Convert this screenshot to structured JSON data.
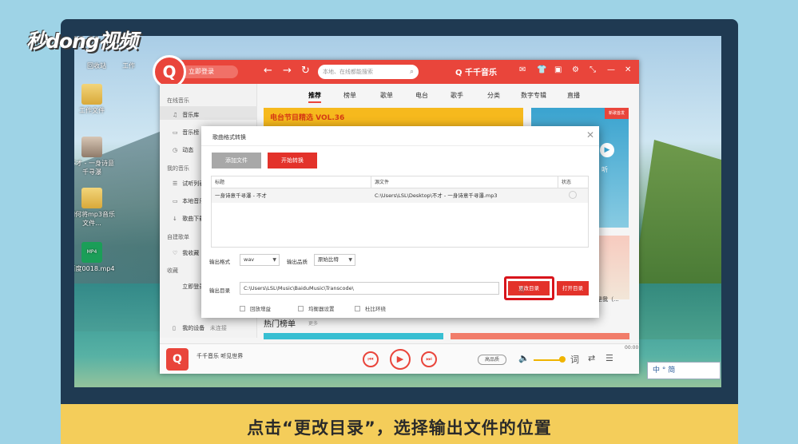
{
  "logo": "秒dong视频",
  "caption": "点击“更改目录”，选择输出文件的位置",
  "desktop_icons": [
    {
      "label": "回收站"
    },
    {
      "label": "工作"
    },
    {
      "label": "工作文件"
    },
    {
      "label": "不才 - 一身诗意千寻瀑"
    },
    {
      "label": "如何将mp3音乐文件..."
    },
    {
      "label": "百度0018.mp4",
      "badge": "MP4"
    }
  ],
  "app": {
    "logo_letter": "Q",
    "login": "立即登录",
    "search_placeholder": "本地、在线都能搜索",
    "brand": "千千音乐",
    "sidebar": {
      "sections": [
        {
          "head": "在线音乐",
          "items": [
            "音乐库",
            "音乐榜",
            "动态"
          ]
        },
        {
          "head": "我的音乐",
          "items": [
            "试听列表",
            "本地音乐",
            "歌曲下载"
          ]
        },
        {
          "head": "自建歌单",
          "items": [
            "我收藏"
          ]
        },
        {
          "head": "收藏",
          "items": [
            "立即登录..."
          ]
        }
      ],
      "device": "我的设备",
      "device_status": "未连接"
    },
    "tabs": [
      "推荐",
      "榜单",
      "歌单",
      "电台",
      "歌手",
      "分类",
      "数字专辑",
      "直播"
    ],
    "banner_text": "电台节目精选 VOL.36",
    "banner_right_tag": "新歌首发",
    "banner_right_text": "听",
    "thumb_caption": "用是我（...",
    "hot_title": "热门榜单",
    "hot_more": "更多",
    "player": {
      "text": "千千音乐 听见世界",
      "quality": "高品质",
      "lyric": "词",
      "time": "00:00"
    }
  },
  "dialog": {
    "title": "歌曲格式转换",
    "add_button": "添加文件",
    "start_button": "开始转换",
    "columns": [
      "标题",
      "源文件",
      "状态"
    ],
    "rows": [
      {
        "title": "一身诗意千寻瀑 - 不才",
        "source": "C:\\Users\\LSL\\Desktop\\不才 - 一身诗意千寻瀑.mp3",
        "status": ""
      }
    ],
    "format_label": "输出格式",
    "format_value": "wav",
    "quality_label": "输出品质",
    "quality_value": "原始比特",
    "dir_label": "输出目录",
    "dir_value": "C:\\Users\\LSL\\Music\\BaiduMusic\\Transcode\\",
    "change_dir_button": "更改目录",
    "open_dir_button": "打开目录",
    "options": [
      "回放增益",
      "均衡器设置",
      "杜比环绕"
    ]
  },
  "ime": "中 ° 简",
  "colors": {
    "accent": "#e3322a",
    "caption_band": "#f4cd5a",
    "frame": "#1f3a52"
  }
}
